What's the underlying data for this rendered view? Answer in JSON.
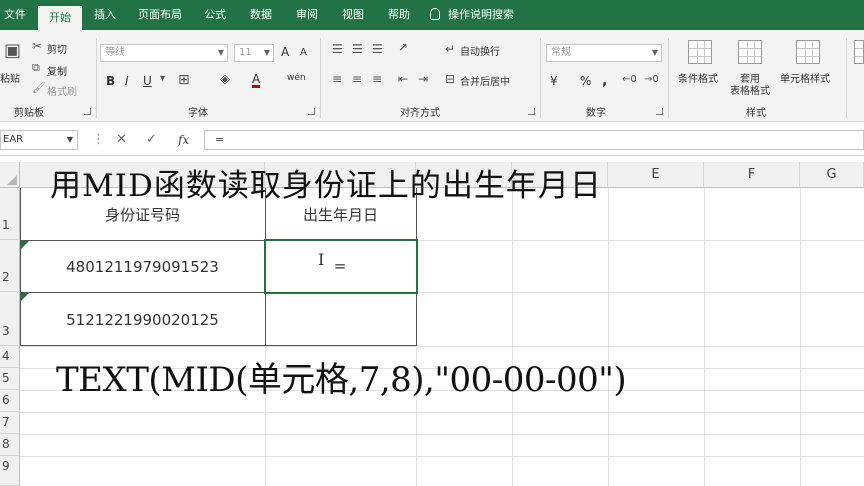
{
  "tabs": [
    "文件",
    "开始",
    "插入",
    "页面布局",
    "公式",
    "数据",
    "审阅",
    "视图",
    "帮助"
  ],
  "active_tab": "开始",
  "tell_me": "操作说明搜索",
  "ribbon": {
    "clipboard": {
      "label": "剪贴板",
      "paste": "粘贴",
      "cut": "剪切",
      "copy": "复制",
      "format_painter": "格式刷"
    },
    "font": {
      "label": "字体",
      "font_name": "等线",
      "font_size": "11",
      "bold": "B",
      "italic": "I",
      "underline": "U",
      "font_color": "A",
      "increase": "A",
      "decrease": "A",
      "phonetic": "wén"
    },
    "alignment": {
      "label": "对齐方式",
      "wrap_text": "自动换行",
      "merge_center": "合并后居中"
    },
    "number": {
      "label": "数字",
      "format": "常规",
      "currency": "¥",
      "percent": "%",
      "comma": ","
    },
    "styles": {
      "label": "样式",
      "conditional": "条件格式",
      "table_format_1": "套用",
      "table_format_2": "表格格式",
      "cell_styles": "单元格样式"
    }
  },
  "formula_bar": {
    "name_box": "EAR",
    "cancel": "✕",
    "confirm": "✓",
    "fx": "fx",
    "content": "="
  },
  "columns": [
    "",
    "",
    "",
    "",
    "E",
    "F",
    "G"
  ],
  "rows": [
    "1",
    "2",
    "3",
    "4",
    "5",
    "6",
    "7",
    "8",
    "9"
  ],
  "table": {
    "header_a": "身份证号码",
    "header_b": "出生年月日",
    "id_1": "480121197909152 3",
    "id_1_text": "4801211979091523",
    "id_2_text": "5121221990020125",
    "editing_value": "="
  },
  "overlay": {
    "title": "用MID函数读取身份证上的出生年月日",
    "formula": "TEXT(MID(单元格,7,8),\"00-00-00\")"
  }
}
